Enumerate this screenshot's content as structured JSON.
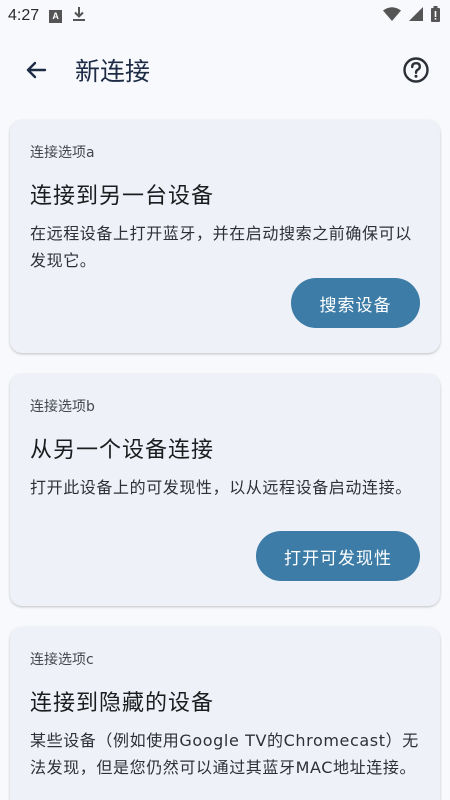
{
  "status_bar": {
    "time": "4:27",
    "notification_box_letter": "A",
    "icons": [
      "text-notification-icon",
      "download-icon",
      "wifi-icon",
      "signal-icon",
      "battery-icon"
    ]
  },
  "app_bar": {
    "title": "新连接",
    "back_icon": "arrow-back-icon",
    "help_icon": "help-circle-icon"
  },
  "cards": [
    {
      "label": "连接选项a",
      "title": "连接到另一台设备",
      "description": "在远程设备上打开蓝牙，并在启动搜索之前确保可以发现它。",
      "action": "搜索设备"
    },
    {
      "label": "连接选项b",
      "title": "从另一个设备连接",
      "description": "打开此设备上的可发现性，以从远程设备启动连接。",
      "action": "打开可发现性"
    },
    {
      "label": "连接选项c",
      "title": "连接到隐藏的设备",
      "description": "某些设备（例如使用Google TV的Chromecast）无法发现，但是您仍然可以通过其蓝牙MAC地址连接。"
    }
  ],
  "colors": {
    "background": "#f8f9fc",
    "card_background": "#eef2f8",
    "accent_button": "#3c7ca7",
    "title_text": "#1d2b45"
  }
}
